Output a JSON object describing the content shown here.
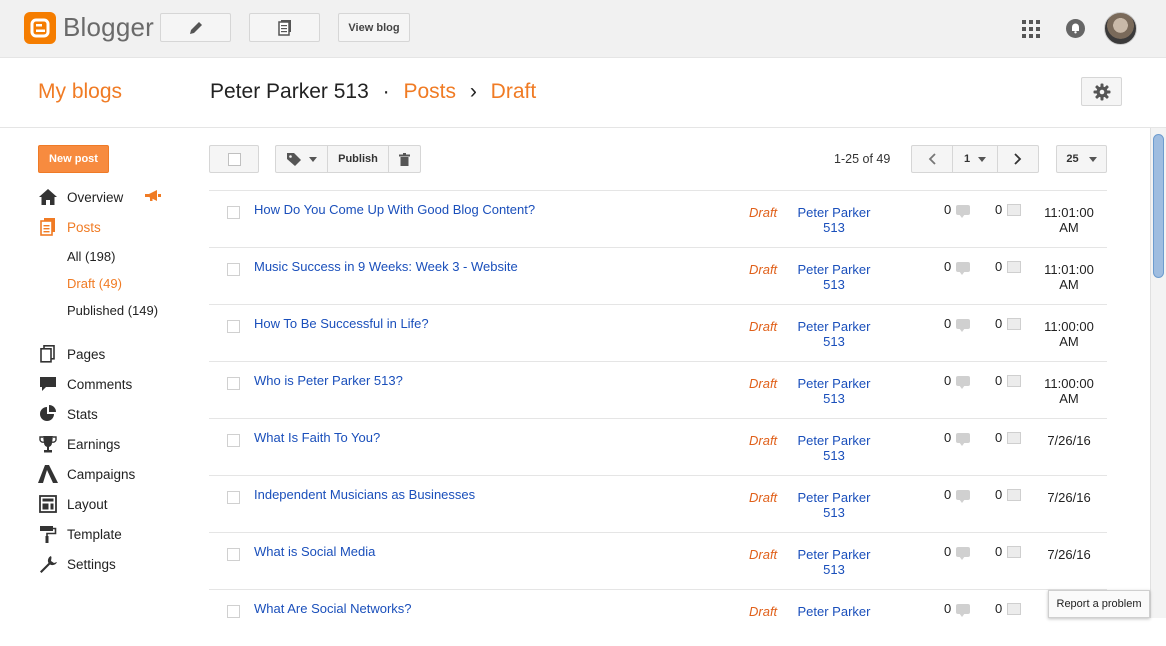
{
  "topbar": {
    "brand": "Blogger",
    "view_blog": "View blog"
  },
  "header": {
    "my_blogs": "My blogs",
    "blog_name": "Peter Parker 513",
    "separator": "·",
    "posts": "Posts",
    "arrow": "›",
    "draft": "Draft"
  },
  "sidebar": {
    "new_post": "New post",
    "overview": "Overview",
    "posts": "Posts",
    "sub": [
      "All (198)",
      "Draft (49)",
      "Published (149)"
    ],
    "items": [
      "Pages",
      "Comments",
      "Stats",
      "Earnings",
      "Campaigns",
      "Layout",
      "Template",
      "Settings"
    ]
  },
  "toolbar": {
    "publish": "Publish",
    "range": "1-25 of 49",
    "page": "1",
    "per_page": "25"
  },
  "posts": [
    {
      "title": "How Do You Come Up With Good Blog Content?",
      "status": "Draft",
      "author_1": "Peter Parker",
      "author_2": "513",
      "comments": "0",
      "views": "0",
      "time_1": "11:01:00",
      "time_2": "AM"
    },
    {
      "title": "Music Success in 9 Weeks: Week 3 - Website",
      "status": "Draft",
      "author_1": "Peter Parker",
      "author_2": "513",
      "comments": "0",
      "views": "0",
      "time_1": "11:01:00",
      "time_2": "AM"
    },
    {
      "title": "How To Be Successful in Life?",
      "status": "Draft",
      "author_1": "Peter Parker",
      "author_2": "513",
      "comments": "0",
      "views": "0",
      "time_1": "11:00:00",
      "time_2": "AM"
    },
    {
      "title": "Who is Peter Parker 513?",
      "status": "Draft",
      "author_1": "Peter Parker",
      "author_2": "513",
      "comments": "0",
      "views": "0",
      "time_1": "11:00:00",
      "time_2": "AM"
    },
    {
      "title": "What Is Faith To You?",
      "status": "Draft",
      "author_1": "Peter Parker",
      "author_2": "513",
      "comments": "0",
      "views": "0",
      "time_1": "7/26/16",
      "time_2": ""
    },
    {
      "title": "Independent Musicians as Businesses",
      "status": "Draft",
      "author_1": "Peter Parker",
      "author_2": "513",
      "comments": "0",
      "views": "0",
      "time_1": "7/26/16",
      "time_2": ""
    },
    {
      "title": "What is Social Media",
      "status": "Draft",
      "author_1": "Peter Parker",
      "author_2": "513",
      "comments": "0",
      "views": "0",
      "time_1": "7/26/16",
      "time_2": ""
    },
    {
      "title": "What Are Social Networks?",
      "status": "Draft",
      "author_1": "Peter Parker",
      "author_2": "",
      "comments": "0",
      "views": "0",
      "time_1": "",
      "time_2": ""
    }
  ],
  "report_problem": "Report a problem",
  "colors": {
    "accent": "#f07b24",
    "link": "#1a4fbb",
    "logo": "#f57d00"
  }
}
